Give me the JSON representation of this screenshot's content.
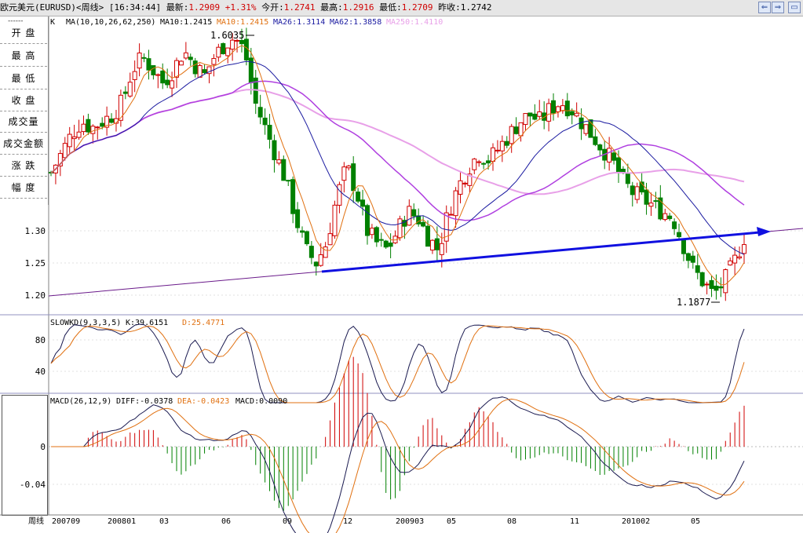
{
  "header": {
    "title": "欧元美元(EURUSD)<周线>",
    "time": "[16:34:44]",
    "latest_label": "最新:",
    "latest_value": "1.2909",
    "change": "+1.31%",
    "open_label": "今开:",
    "open_value": "1.2741",
    "high_label": "最高:",
    "high_value": "1.2916",
    "low_label": "最低:",
    "low_value": "1.2709",
    "prevclose_label": "昨收:",
    "prevclose_value": "1.2742"
  },
  "window_buttons": {
    "back": "⇐",
    "forward": "⇒",
    "zoom": "▭",
    "close": "×"
  },
  "sidebar": {
    "dashes": "------",
    "items": [
      "开  盘",
      "最  高",
      "最  低",
      "收  盘",
      "成交量",
      "成交金额",
      "涨  跌",
      "幅  度"
    ]
  },
  "price_panel": {
    "k_label": "K",
    "ma_header": "MA(10,10,26,62,250)",
    "ma10a": "MA10:1.2415",
    "ma10b": "MA10:1.2415",
    "ma26": "MA26:1.3114",
    "ma62": "MA62:1.3858",
    "ma250": "MA250:1.4110",
    "y_ticks": [
      "1.30",
      "1.25",
      "1.20"
    ],
    "high_marker": "1.6035",
    "low_marker": "1.1877"
  },
  "kd_panel": {
    "header": "SLOWKD(9,3,3,5)",
    "k": "K:39.6151",
    "d": "D:25.4771",
    "y_ticks": [
      "80",
      "40"
    ]
  },
  "macd_panel": {
    "header": "MACD(26,12,9)",
    "diff": "DIFF:-0.0378",
    "dea": "DEA:-0.0423",
    "macd": "MACD:0.0090",
    "y_ticks": [
      "0",
      "-0.04"
    ]
  },
  "x_axis": {
    "period_label": "周线",
    "labels": [
      "200709",
      "200801",
      "03",
      "06",
      "09",
      "12",
      "200903",
      "05",
      "08",
      "11",
      "201002",
      "05"
    ]
  },
  "colors": {
    "up": "#d00000",
    "down": "#008000",
    "ma10": "#e07010",
    "ma26": "#1a1aa0",
    "ma62": "#b040e0",
    "ma250": "#e8a0e8",
    "trend": "#1010e0"
  },
  "chart_data": {
    "type": "candlestick",
    "symbol": "EURUSD",
    "period": "weekly",
    "x": [
      "200709",
      "200801",
      "03",
      "06",
      "09",
      "12",
      "200903",
      "05",
      "08",
      "11",
      "201002",
      "05"
    ],
    "close_path": [
      1.39,
      1.42,
      1.45,
      1.47,
      1.46,
      1.47,
      1.48,
      1.5,
      1.55,
      1.57,
      1.55,
      1.53,
      1.55,
      1.58,
      1.56,
      1.54,
      1.57,
      1.59,
      1.6,
      1.58,
      1.5,
      1.46,
      1.42,
      1.38,
      1.32,
      1.27,
      1.25,
      1.28,
      1.35,
      1.4,
      1.36,
      1.3,
      1.28,
      1.27,
      1.3,
      1.33,
      1.32,
      1.29,
      1.27,
      1.33,
      1.37,
      1.4,
      1.42,
      1.41,
      1.43,
      1.45,
      1.47,
      1.48,
      1.47,
      1.49,
      1.5,
      1.49,
      1.47,
      1.45,
      1.43,
      1.41,
      1.38,
      1.36,
      1.35,
      1.34,
      1.33,
      1.32,
      1.28,
      1.24,
      1.22,
      1.2,
      1.22,
      1.25,
      1.29
    ],
    "annotations": {
      "high": 1.6035,
      "low": 1.1877
    },
    "trendline": {
      "from": 1.235,
      "to": 1.295
    },
    "ylim": [
      1.18,
      1.62
    ]
  }
}
